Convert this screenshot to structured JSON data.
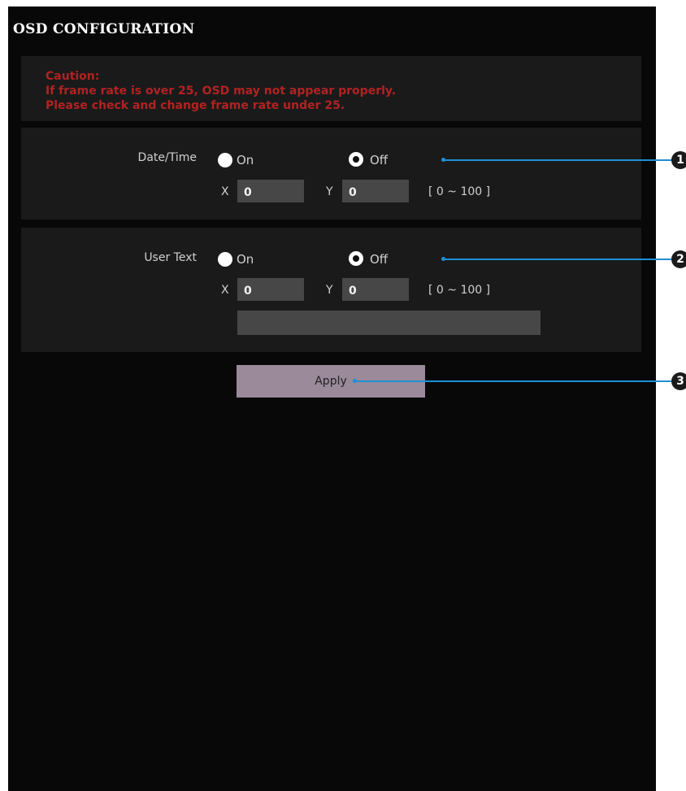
{
  "header": {
    "title": "OSD CONFIGURATION"
  },
  "caution": {
    "heading": "Caution:",
    "line1": "If frame rate is over 25, OSD may not appear properly.",
    "line2": "Please check and change frame rate under 25."
  },
  "date_time": {
    "label": "Date/Time",
    "on_label": "On",
    "off_label": "Off",
    "selected": "Off",
    "x_label": "X",
    "y_label": "Y",
    "x_value": "0",
    "y_value": "0",
    "range": "[ 0 ~ 100 ]"
  },
  "user_text": {
    "label": "User Text",
    "on_label": "On",
    "off_label": "Off",
    "selected": "Off",
    "x_label": "X",
    "y_label": "Y",
    "x_value": "0",
    "y_value": "0",
    "range": "[ 0 ~ 100 ]",
    "text_value": ""
  },
  "actions": {
    "apply_label": "Apply"
  },
  "callouts": [
    "1",
    "2",
    "3"
  ],
  "colors": {
    "background": "#080808",
    "section": "#1a1a1a",
    "caution_text": "#b22222",
    "input": "#474747",
    "apply_button": "#9a8a9a",
    "callout": "#1f8fd6"
  }
}
